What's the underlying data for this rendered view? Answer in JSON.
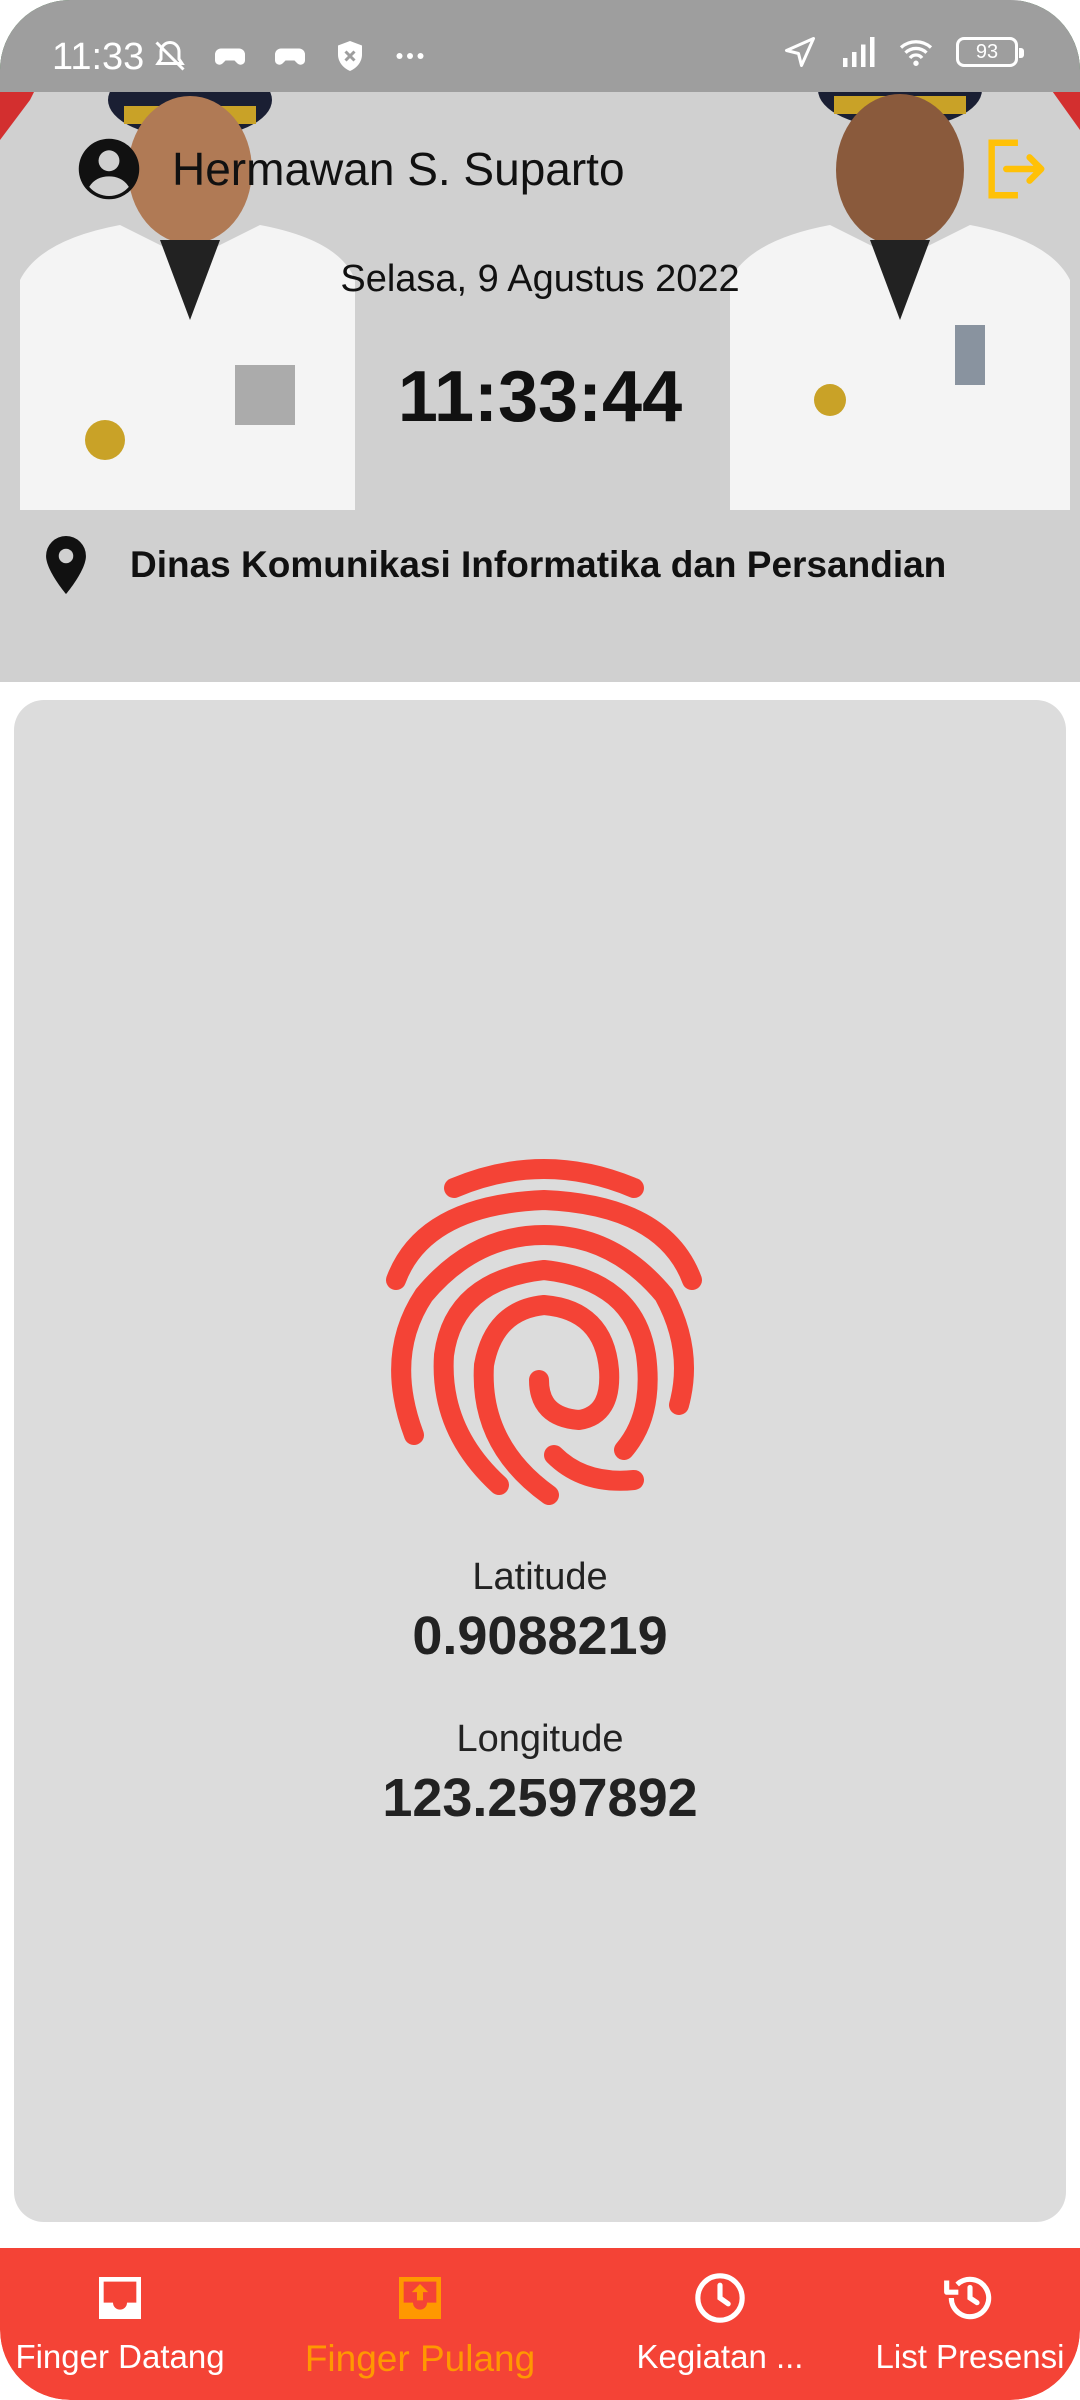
{
  "status_bar": {
    "time": "11:33",
    "battery": "93"
  },
  "header": {
    "user_name": "Hermawan S. Suparto",
    "date": "Selasa, 9 Agustus 2022",
    "clock": "11:33:44",
    "location": "Dinas Komunikasi Informatika dan Persandian"
  },
  "coordinates": {
    "latitude_label": "Latitude",
    "latitude_value": "0.9088219",
    "longitude_label": "Longitude",
    "longitude_value": "123.2597892"
  },
  "bottom_nav": {
    "items": [
      {
        "label": "Finger Datang",
        "icon": "inbox-icon"
      },
      {
        "label": "Finger Pulang",
        "icon": "outbox-icon",
        "active": true
      },
      {
        "label": "Kegiatan ...",
        "icon": "clock-icon"
      },
      {
        "label": "List Presensi",
        "icon": "history-icon"
      }
    ]
  },
  "colors": {
    "accent": "#f44336",
    "active_nav": "#ff9800",
    "logout": "#ffc107",
    "header_bg": "#d0d0d0",
    "card_bg": "#dcdcdc"
  }
}
